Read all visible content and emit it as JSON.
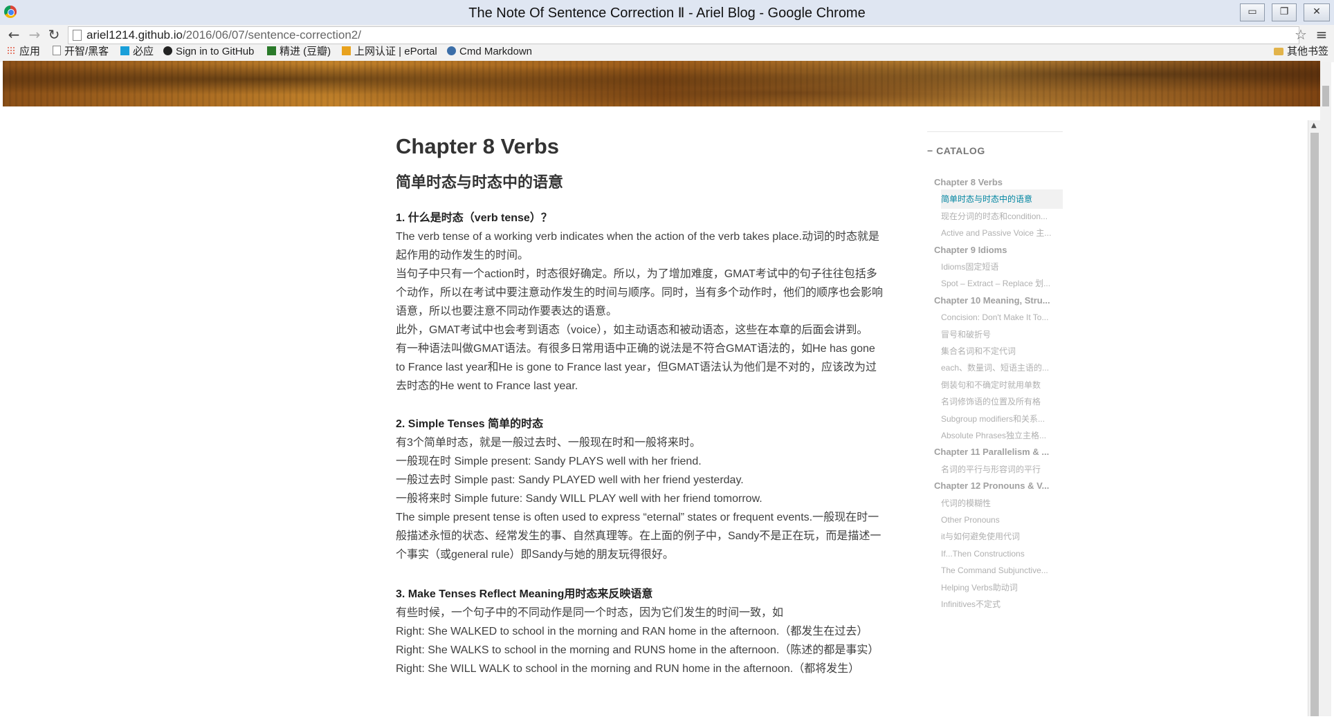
{
  "window": {
    "title": "The Note Of Sentence Correction Ⅱ - Ariel Blog - Google Chrome",
    "controls": {
      "minimize": "▭",
      "restore": "❐",
      "close": "✕"
    }
  },
  "toolbar": {
    "back": "←",
    "forward": "→",
    "reload": "↻",
    "url_host": "ariel1214.github.io",
    "url_path": "/2016/06/07/sentence-correction2/",
    "star": "☆",
    "menu": "≡"
  },
  "bookmarks": {
    "items": [
      {
        "label": "应用",
        "icon": "apps-grid-icon",
        "color": "#e0533d"
      },
      {
        "label": "开智/黑客",
        "icon": "page-icon",
        "color": "#888888"
      },
      {
        "label": "必应",
        "icon": "bing-icon",
        "color": "#1a9fd9"
      },
      {
        "label": "Sign in to GitHub",
        "icon": "github-icon",
        "color": "#222222"
      },
      {
        "label": "精进 (豆瓣)",
        "icon": "douban-icon",
        "color": "#2a7a2a"
      },
      {
        "label": "上网认证 | ePortal",
        "icon": "eportal-icon",
        "color": "#e8a21e"
      },
      {
        "label": "Cmd Markdown",
        "icon": "cmd-markdown-icon",
        "color": "#3b6ea8"
      }
    ],
    "other": "其他书签"
  },
  "article": {
    "title": "Chapter 8 Verbs",
    "subtitle": "简单时态与时态中的语意",
    "sections": [
      {
        "heading": "1. 什么是时态（verb tense）？",
        "lines": [
          "The verb tense of a working verb indicates when the action of the verb takes place.动词的时态就是",
          "起作用的动作发生的时间。",
          "当句子中只有一个action时，时态很好确定。所以，为了增加难度，GMAT考试中的句子往往包括多",
          "个动作，所以在考试中要注意动作发生的时间与顺序。同时，当有多个动作时，他们的顺序也会影响",
          "语意，所以也要注意不同动作要表达的语意。",
          "此外，GMAT考试中也会考到语态（voice），如主动语态和被动语态，这些在本章的后面会讲到。",
          "有一种语法叫做GMAT语法。有很多日常用语中正确的说法是不符合GMAT语法的，如He has gone",
          "to France last year和He is gone to France last year，但GMAT语法认为他们是不对的，应该改为过",
          "去时态的He went to France last year."
        ]
      },
      {
        "heading": "2. Simple Tenses 简单的时态",
        "lines": [
          "有3个简单时态，就是一般过去时、一般现在时和一般将来时。",
          "一般现在时 Simple present: Sandy PLAYS well with her friend.",
          "一般过去时 Simple past: Sandy PLAYED well with her friend yesterday.",
          "一般将来时 Simple future: Sandy WILL PLAY well with her friend tomorrow.",
          "The simple present tense is often used to express “eternal” states or frequent events.一般现在时一",
          "般描述永恒的状态、经常发生的事、自然真理等。在上面的例子中，Sandy不是正在玩，而是描述一",
          "个事实（或general rule）即Sandy与她的朋友玩得很好。"
        ]
      },
      {
        "heading": "3. Make Tenses Reflect Meaning用时态来反映语意",
        "lines": [
          "有些时候，一个句子中的不同动作是同一个时态，因为它们发生的时间一致，如",
          "Right: She WALKED to school in the morning and RAN home in the afternoon.（都发生在过去）",
          "Right: She WALKS to school in the morning and RUNS home in the afternoon.（陈述的都是事实）",
          "Right: She WILL WALK to school in the morning and RUN home in the afternoon.（都将发生）"
        ]
      }
    ]
  },
  "catalog": {
    "title": "CATALOG",
    "collapse_icon": "−",
    "items": [
      {
        "label": "Chapter 8 Verbs",
        "level": "ch"
      },
      {
        "label": "简单时态与时态中的语意",
        "level": "active"
      },
      {
        "label": "现在分词的时态和condition...",
        "level": "sub"
      },
      {
        "label": "Active and Passive Voice 主...",
        "level": "sub"
      },
      {
        "label": "Chapter 9 Idioms",
        "level": "ch"
      },
      {
        "label": "Idioms固定短语",
        "level": "sub"
      },
      {
        "label": "Spot – Extract – Replace 划...",
        "level": "sub"
      },
      {
        "label": "Chapter 10 Meaning, Stru...",
        "level": "ch"
      },
      {
        "label": "Concision: Don't Make It To...",
        "level": "sub"
      },
      {
        "label": "冒号和破折号",
        "level": "sub"
      },
      {
        "label": "集合名词和不定代词",
        "level": "sub"
      },
      {
        "label": "each、数量词、短语主语的...",
        "level": "sub"
      },
      {
        "label": "倒装句和不确定时就用单数",
        "level": "sub"
      },
      {
        "label": "名词修饰语的位置及所有格",
        "level": "sub"
      },
      {
        "label": "Subgroup modifiers和关系...",
        "level": "sub"
      },
      {
        "label": "Absolute Phrases独立主格...",
        "level": "sub"
      },
      {
        "label": "Chapter 11 Parallelism & ...",
        "level": "ch"
      },
      {
        "label": "名词的平行与形容词的平行",
        "level": "sub"
      },
      {
        "label": "Chapter 12 Pronouns & V...",
        "level": "ch"
      },
      {
        "label": "代词的模糊性",
        "level": "sub"
      },
      {
        "label": "Other Pronouns",
        "level": "sub"
      },
      {
        "label": "it与如何避免使用代词",
        "level": "sub"
      },
      {
        "label": "If...Then Constructions",
        "level": "sub"
      },
      {
        "label": "The Command Subjunctive...",
        "level": "sub"
      },
      {
        "label": "Helping Verbs助动词",
        "level": "sub"
      },
      {
        "label": "Infinitives不定式",
        "level": "sub"
      }
    ]
  }
}
